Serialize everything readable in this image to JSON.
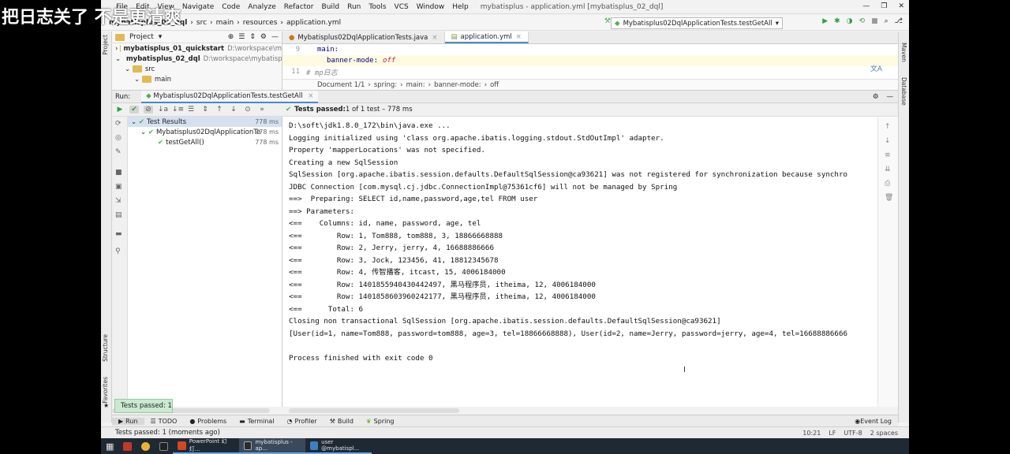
{
  "overlay_caption": "把日志关了 不是更清爽",
  "menu": {
    "items": [
      "File",
      "Edit",
      "View",
      "Navigate",
      "Code",
      "Analyze",
      "Refactor",
      "Build",
      "Run",
      "Tools",
      "VCS",
      "Window",
      "Help"
    ],
    "window_title": "mybatisplus - application.yml [mybatisplus_02_dql]"
  },
  "navbar": {
    "crumbs": [
      "mybatisplus_02_dql",
      "src",
      "main",
      "resources",
      "application.yml"
    ]
  },
  "run_config": "Mybatisplus02DqlApplicationTests.testGetAll",
  "project": {
    "header": "Project",
    "rows": [
      {
        "name": "mybatisplus_01_quickstart",
        "path": "D:\\workspace\\m"
      },
      {
        "name": "mybatisplus_02_dql",
        "path": "D:\\workspace\\mybatisp"
      },
      {
        "name": "src",
        "path": ""
      },
      {
        "name": "main",
        "path": ""
      }
    ]
  },
  "editor": {
    "tabs": [
      "Mybatisplus02DqlApplicationTests.java",
      "application.yml"
    ],
    "lines": [
      {
        "num": "9",
        "key": "main:",
        "value": ""
      },
      {
        "num": "",
        "key": "banner-mode:",
        "value": "off"
      },
      {
        "num": "11",
        "key": "# mp日志",
        "value": ""
      }
    ],
    "crumbs": [
      "Document 1/1",
      "spring:",
      "main:",
      "banner-mode:",
      "off"
    ]
  },
  "run": {
    "label": "Run:",
    "tab": "Mybatisplus02DqlApplicationTests.testGetAll",
    "status": "Tests passed: 1 of 1 test – 778 ms",
    "status_bold": "Tests passed:",
    "status_rest": " 1 of 1 test – 778 ms"
  },
  "tests": [
    {
      "label": "Test Results",
      "time": "778 ms"
    },
    {
      "label": "Mybatisplus02DqlApplicationTe",
      "time": "778 ms"
    },
    {
      "label": "testGetAll()",
      "time": "778 ms"
    }
  ],
  "console": [
    "D:\\soft\\jdk1.8.0_172\\bin\\java.exe ...",
    "Logging initialized using 'class org.apache.ibatis.logging.stdout.StdOutImpl' adapter.",
    "Property 'mapperLocations' was not specified.",
    "Creating a new SqlSession",
    "SqlSession [org.apache.ibatis.session.defaults.DefaultSqlSession@ca93621] was not registered for synchronization because synchro",
    "JDBC Connection [com.mysql.cj.jdbc.ConnectionImpl@75361cf6] will not be managed by Spring",
    "==>  Preparing: SELECT id,name,password,age,tel FROM user",
    "==> Parameters: ",
    "<==    Columns: id, name, password, age, tel",
    "<==        Row: 1, Tom888, tom888, 3, 18866668888",
    "<==        Row: 2, Jerry, jerry, 4, 16688886666",
    "<==        Row: 3, Jock, 123456, 41, 18812345678",
    "<==        Row: 4, 传智播客, itcast, 15, 4006184000",
    "<==        Row: 1401855940430442497, 黑马程序员, itheima, 12, 4006184000",
    "<==        Row: 1401858603960242177, 黑马程序员, itheima, 12, 4006184000",
    "<==      Total: 6",
    "Closing non transactional SqlSession [org.apache.ibatis.session.defaults.DefaultSqlSession@ca93621]",
    "[User(id=1, name=Tom888, password=tom888, age=3, tel=18866668888), User(id=2, name=Jerry, password=jerry, age=4, tel=16688886666",
    "",
    "Process finished with exit code 0"
  ],
  "tooltip": "Tests passed: 1",
  "bottom_tabs": [
    "Run",
    "TODO",
    "Problems",
    "Terminal",
    "Profiler",
    "Build",
    "Spring"
  ],
  "event_log": "Event Log",
  "statusbar": {
    "text": "Tests passed: 1 (moments ago)",
    "position": "10:21",
    "line_sep": "LF",
    "encoding": "UTF-8",
    "indent": "2 spaces"
  },
  "side_labels": {
    "project": "Project",
    "structure": "Structure",
    "favorites": "Favorites",
    "maven": "Maven",
    "database": "Database"
  },
  "taskbar": {
    "tasks": [
      "PowerPoint 幻灯...",
      "mybatisplus - ap...",
      "user @mybatispl..."
    ]
  }
}
